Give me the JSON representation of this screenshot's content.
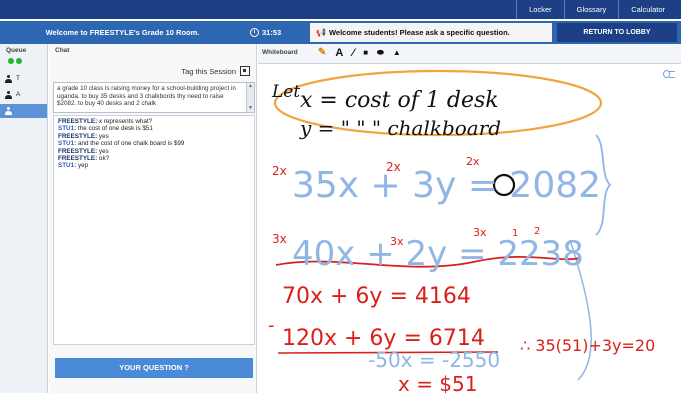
{
  "topnav": {
    "links": [
      "Locker",
      "Glossary",
      "Calculator"
    ]
  },
  "header": {
    "title": "Welcome to FREESTYLE's Grade 10 Room.",
    "timer": "31:53",
    "announcement": "Welcome students! Please ask a specific question.",
    "lobby_button": "RETURN TO LOBBY"
  },
  "queue": {
    "label": "Queue",
    "rows": [
      {
        "letter": "T"
      },
      {
        "letter": "A"
      },
      {
        "letter": ""
      }
    ]
  },
  "chat": {
    "label": "Chat",
    "tag_label": "Tag this Session",
    "question": "a grade 10 class is raising money for a school-building project in uganda. to buy 35 desks and 3 chalkbords thy need to raise $2082. to buy 40 desks and 2 chalk",
    "messages": [
      {
        "who": "FREESTYLE:",
        "text": " x represents what?"
      },
      {
        "who": "STU1:",
        "text": " the cost of one desk is $51"
      },
      {
        "who": "FREESTYLE:",
        "text": " yes"
      },
      {
        "who": "STU1:",
        "text": " and the cost of one chalk board is $99"
      },
      {
        "who": "FREESTYLE:",
        "text": " yes"
      },
      {
        "who": "FREESTYLE:",
        "text": " ok?"
      },
      {
        "who": "STU1:",
        "text": " yep"
      }
    ],
    "ask_button": "YOUR QUESTION ?"
  },
  "whiteboard": {
    "label": "Whiteboard",
    "tools": [
      "pencil-icon",
      "text-tool-icon",
      "line-tool-icon",
      "rectangle-tool-icon",
      "ellipse-tool-icon",
      "triangle-tool-icon"
    ],
    "handwriting": {
      "let": "Let",
      "def_x": "x = cost of 1 desk",
      "def_y": "y =  \"    \"    \" chalkboard",
      "eq1": "35x + 3y = 2082",
      "eq2": "40x + 2y = 2238",
      "m1": "2x",
      "m2": "2x",
      "m3": "2x",
      "m4": "3x",
      "m5": "3x",
      "m6": "3x",
      "m7": "1",
      "m8": "2",
      "r1": "70x + 6y = 4164",
      "r2": "120x + 6y = 6714",
      "minus": "-",
      "sub": "∴ 35(51)+3y=20",
      "diff": "-50x = -2550",
      "ans": "x = $51"
    }
  },
  "colors": {
    "nav": "#1c3f86",
    "header": "#2e67b1",
    "ink_black": "#111111",
    "ink_blue": "#8fb6e4",
    "ink_red": "#d9211a",
    "ink_orange": "#f0a540"
  }
}
